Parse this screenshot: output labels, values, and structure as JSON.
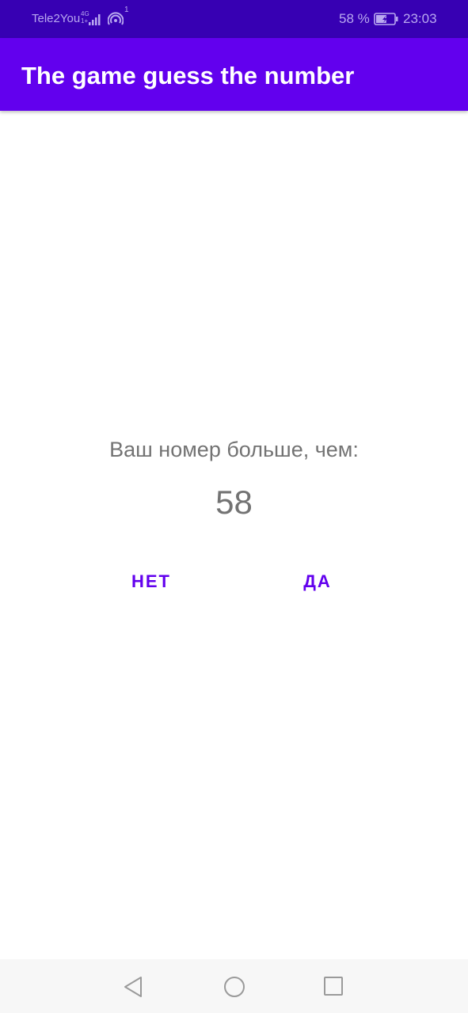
{
  "status_bar": {
    "carrier": "Tele2You",
    "network_type": "4G",
    "network_sub": "1+",
    "hotspot_count": "1",
    "battery_percent": "58 %",
    "battery_level": 58,
    "time": "23:03",
    "background_color": "#3700B3"
  },
  "app_bar": {
    "title": "The game guess the number",
    "background_color": "#6200EE"
  },
  "main": {
    "prompt": "Ваш номер больше, чем:",
    "number": "58",
    "no_button": "НЕТ",
    "yes_button": "ДА",
    "accent_color": "#6200EE"
  },
  "nav_bar": {
    "icons": [
      "back-icon",
      "home-icon",
      "recent-apps-icon"
    ]
  }
}
